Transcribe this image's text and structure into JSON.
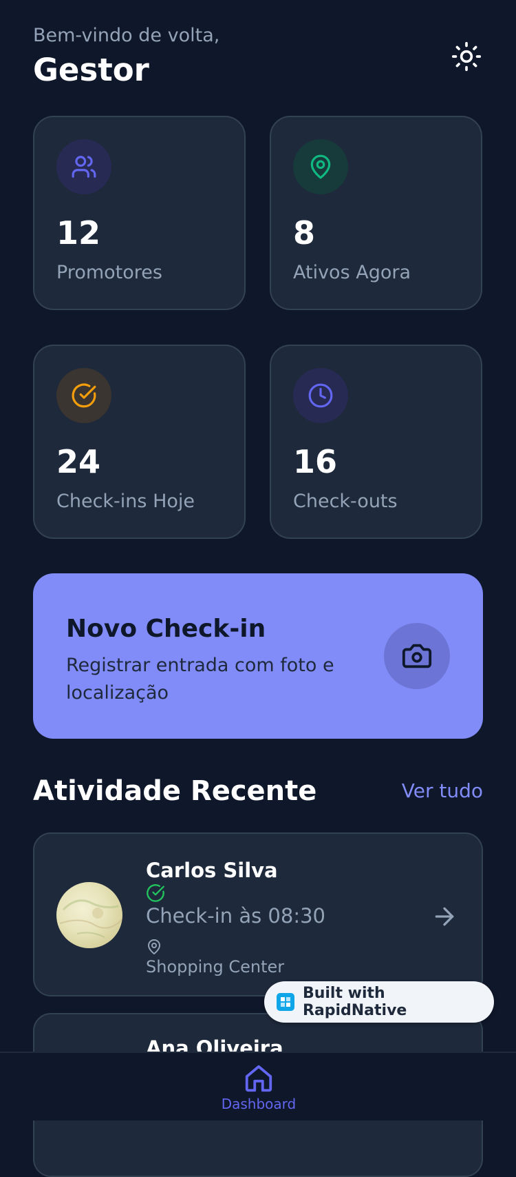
{
  "header": {
    "welcome": "Bem-vindo de volta,",
    "title": "Gestor"
  },
  "stats": [
    {
      "value": "12",
      "label": "Promotores",
      "icon": "users-icon"
    },
    {
      "value": "8",
      "label": "Ativos Agora",
      "icon": "map-pin-icon"
    },
    {
      "value": "24",
      "label": "Check-ins Hoje",
      "icon": "check-circle-icon"
    },
    {
      "value": "16",
      "label": "Check-outs",
      "icon": "clock-icon"
    }
  ],
  "cta": {
    "title": "Novo Check-in",
    "subtitle": "Registrar entrada com foto e localização",
    "icon": "camera-icon"
  },
  "recent": {
    "title": "Atividade Recente",
    "see_all": "Ver tudo",
    "items": [
      {
        "name": "Carlos Silva",
        "time": "Check-in às 08:30",
        "place": "Shopping Center"
      },
      {
        "name": "Ana Oliveira"
      }
    ]
  },
  "badge": {
    "text": "Built with RapidNative"
  },
  "tabbar": {
    "dashboard": "Dashboard"
  },
  "colors": {
    "background": "#0f172a",
    "card": "#1e293b",
    "accent": "#818cf8",
    "success": "#22c55e",
    "warning": "#f59e0b"
  }
}
